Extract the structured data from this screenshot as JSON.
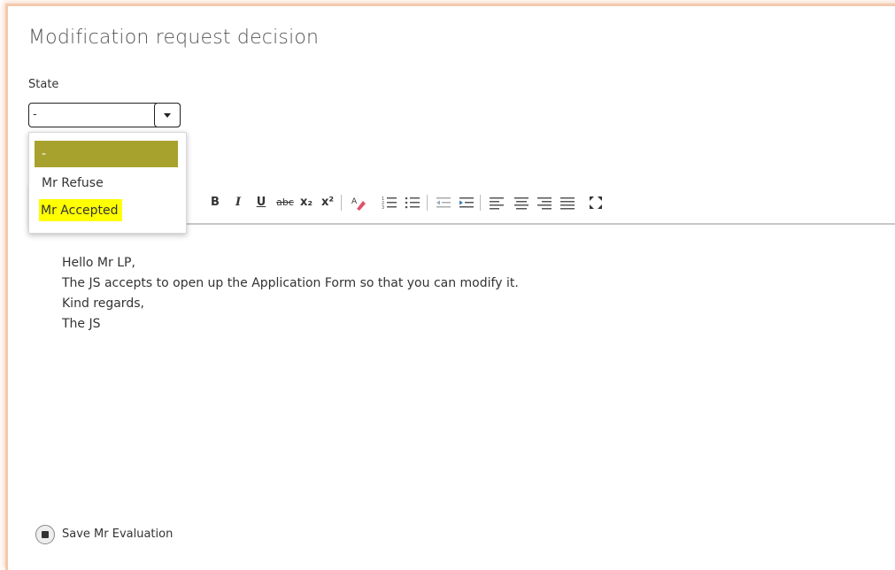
{
  "header": {
    "title": "Modification request decision"
  },
  "state": {
    "label": "State",
    "selected_value": "-",
    "options": [
      "-",
      "Mr Refuse",
      "Mr Accepted"
    ]
  },
  "toolbar": {
    "bold": "B",
    "italic": "I",
    "underline": "U",
    "strike": "abc",
    "subscript": "x₂",
    "superscript": "x²"
  },
  "editor": {
    "lines": [
      "Hello Mr LP,",
      "The JS accepts to open up the Application Form so that you can modify it.",
      "Kind regards,",
      "The JS"
    ]
  },
  "actions": {
    "save_label": "Save Mr Evaluation"
  },
  "colors": {
    "selected_option_bg": "#a7a22d",
    "highlight": "#ffff00",
    "frame": "#f3c9ad"
  }
}
